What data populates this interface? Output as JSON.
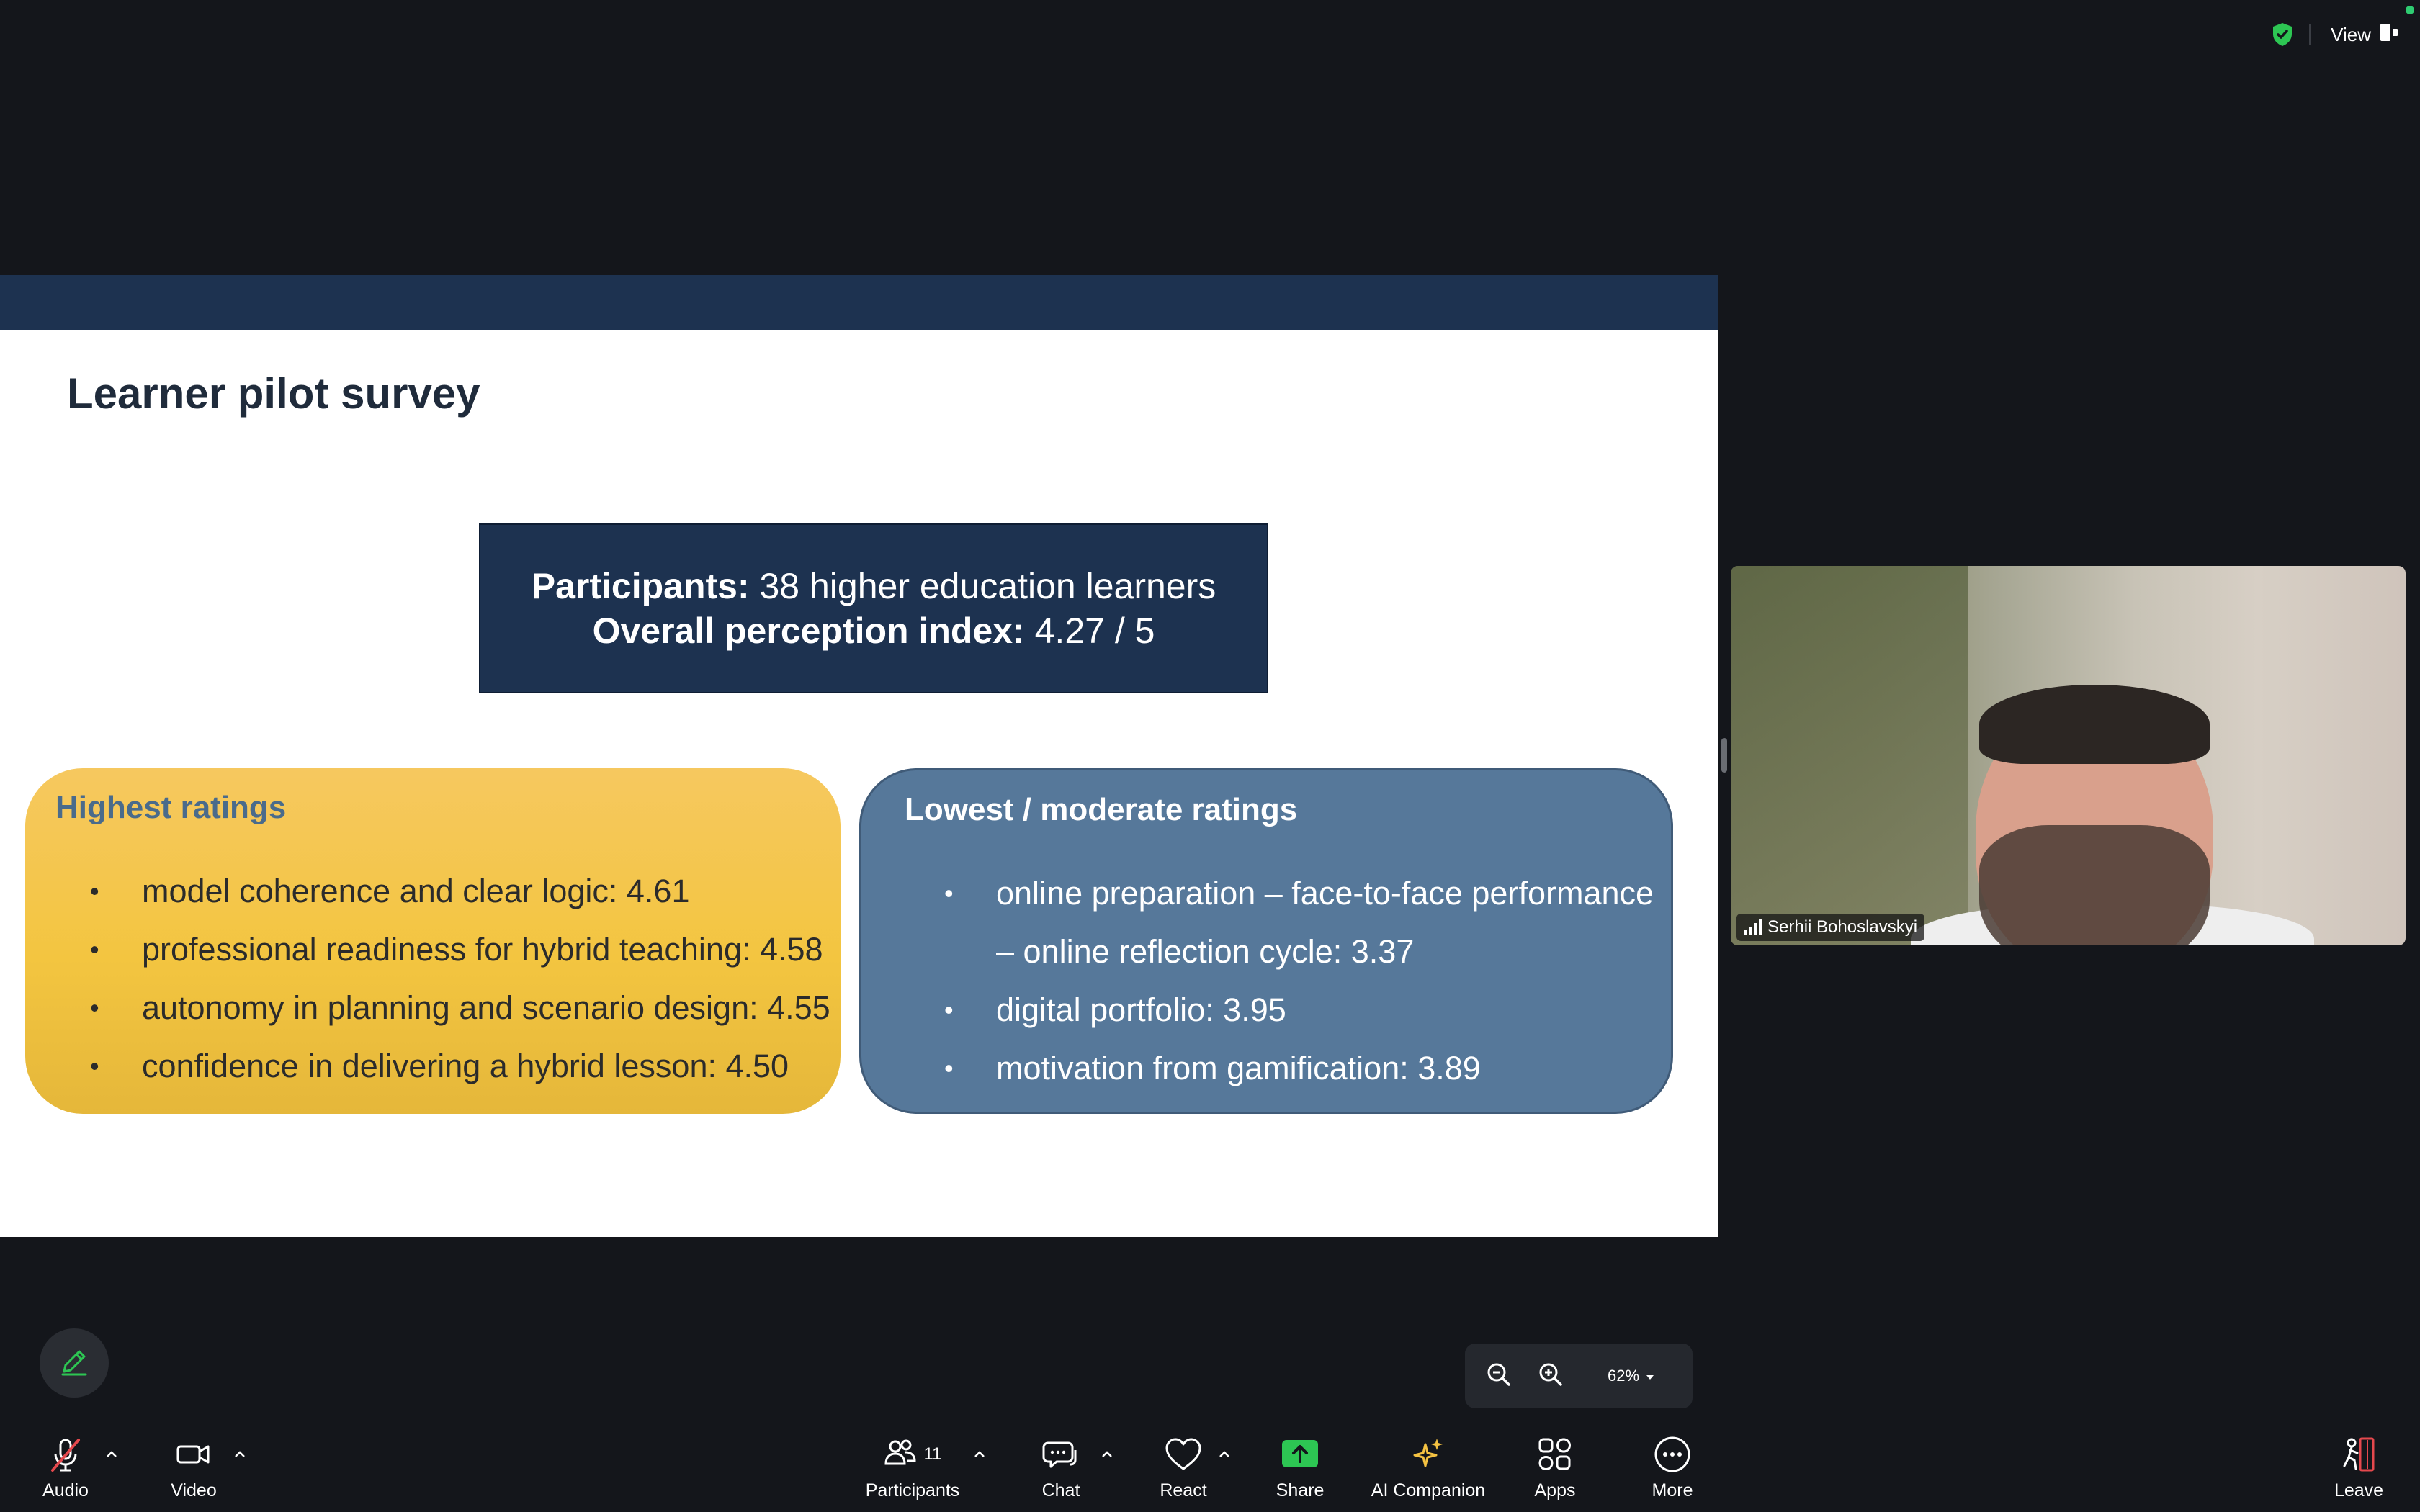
{
  "topbar": {
    "view_label": "View"
  },
  "slide": {
    "title": "Learner pilot survey",
    "participants_label": "Participants:",
    "participants_value": " 38 higher education learners",
    "index_label": "Overall perception index:",
    "index_value": " 4.27 / 5",
    "highest": {
      "title": "Highest ratings",
      "items": [
        "model coherence and clear logic: 4.61",
        "professional readiness for hybrid teaching: 4.58",
        "autonomy in planning and scenario design: 4.55",
        "confidence in delivering a hybrid lesson: 4.50"
      ]
    },
    "lowest": {
      "title": "Lowest / moderate ratings",
      "items": [
        "online preparation – face-to-face performance – online reflection cycle: 3.37",
        "digital portfolio: 3.95",
        "motivation from gamification: 3.89"
      ]
    }
  },
  "participant_video": {
    "name": "Serhii Bohoslavskyi"
  },
  "zoom": {
    "level": "62%"
  },
  "toolbar": {
    "audio": "Audio",
    "video": "Video",
    "participants": "Participants",
    "participants_count": "11",
    "chat": "Chat",
    "react": "React",
    "share": "Share",
    "ai_companion": "AI Companion",
    "apps": "Apps",
    "more": "More",
    "leave": "Leave"
  },
  "colors": {
    "slide_navy": "#1d3250",
    "highest_card": "#f3c540",
    "lowest_card": "#56789a",
    "share_green": "#2dc653",
    "leave_red": "#e5484d",
    "ai_yellow": "#f5c242"
  }
}
